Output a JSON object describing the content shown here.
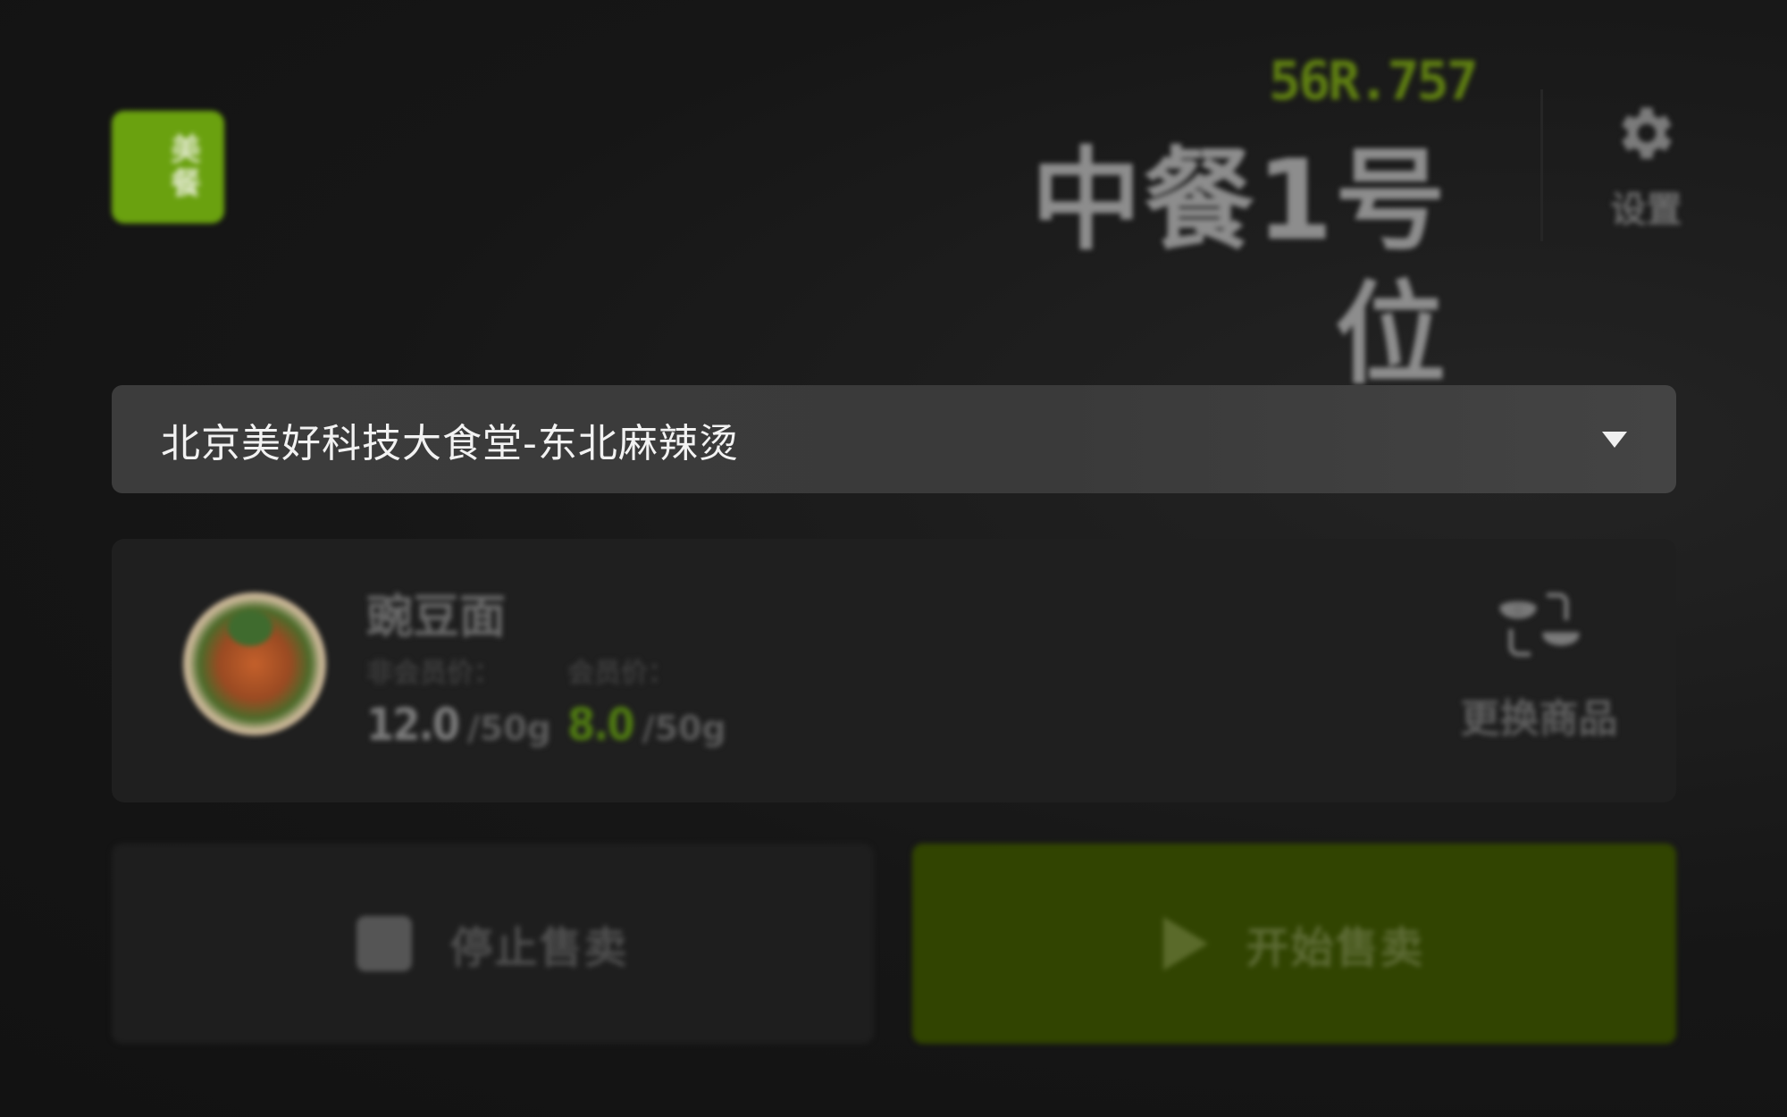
{
  "header": {
    "logo_text": "美餐",
    "device_code": "56R.757",
    "station_name": "中餐1号位",
    "settings_label": "设置",
    "settings_icon": "gear-icon"
  },
  "store_select": {
    "value": "北京美好科技大食堂-东北麻辣烫",
    "icon": "caret-down-icon"
  },
  "product": {
    "name": "豌豆面",
    "standard_price_label": "非会员价：",
    "standard_price": "12.0",
    "standard_unit": "/50g",
    "member_price_label": "会员价：",
    "member_price": "8.0",
    "member_unit": "/50g",
    "change_label": "更换商品",
    "change_icon": "swap-bowls-icon"
  },
  "actions": {
    "stop_label": "停止售卖",
    "start_label": "开始售卖"
  },
  "colors": {
    "accent": "#6aa10f",
    "start_button": "#314401",
    "background": "#141414"
  }
}
